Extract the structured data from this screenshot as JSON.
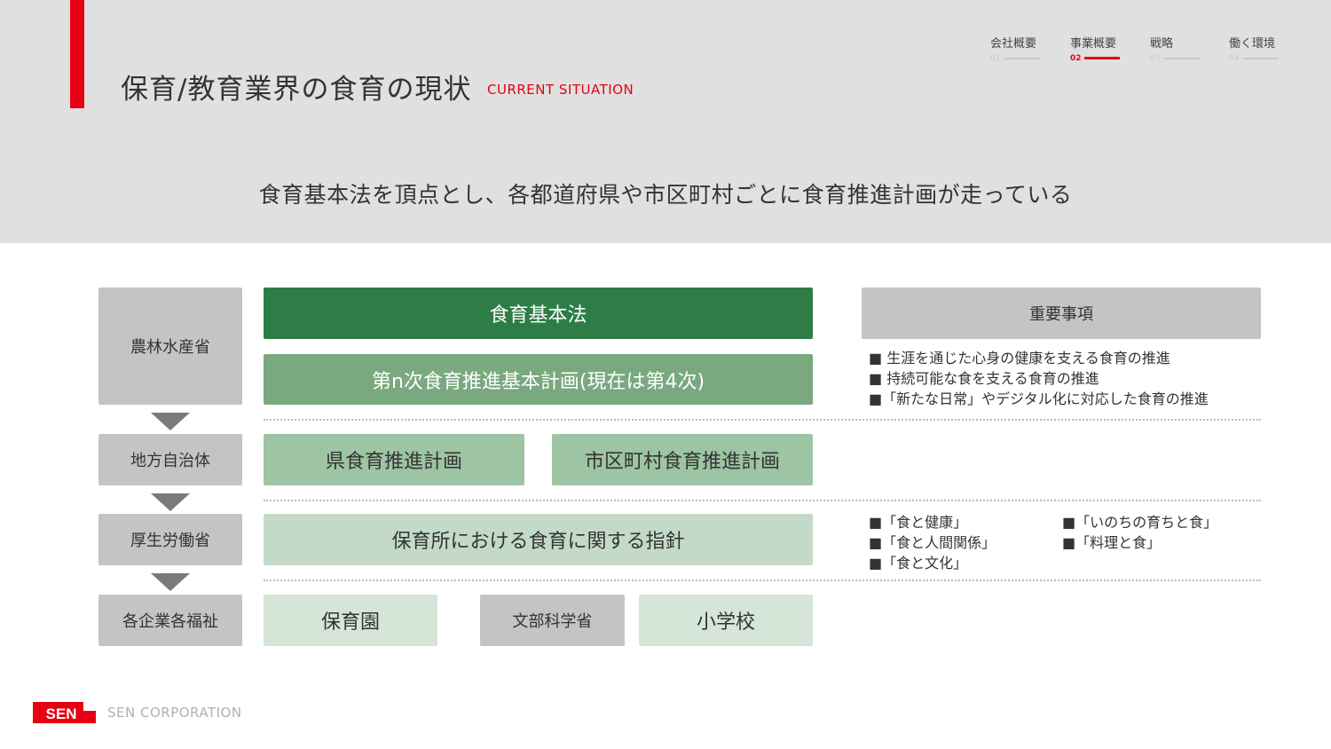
{
  "page": {
    "title": "保育/教育業界の食育の現状",
    "title_en": "CURRENT SITUATION",
    "subtitle": "食育基本法を頂点とし、各都道府県や市区町村ごとに食育推進計画が走っている"
  },
  "nav": [
    {
      "label": "会社概要",
      "num": "01"
    },
    {
      "label": "事業概要",
      "num": "02"
    },
    {
      "label": "戦略",
      "num": "03"
    },
    {
      "label": "働く環境",
      "num": "04"
    }
  ],
  "nav_active_index": 1,
  "diagram": {
    "levels": [
      "農林水産省",
      "地方自治体",
      "厚生労働省",
      "各企業各福祉"
    ],
    "law": "食育基本法",
    "basic_plan": "第n次食育推進基本計画(現在は第4次)",
    "pref_plan": "県食育推進計画",
    "city_plan": "市区町村食育推進計画",
    "guideline": "保育所における食育に関する指針",
    "nursery": "保育園",
    "mext": "文部科学省",
    "elementary": "小学校",
    "important_header": "重要事項",
    "important_items": [
      "■ 生涯を通じた心身の健康を支える食育の推進",
      "■ 持続可能な食を支える食育の推進",
      "■「新たな日常」やデジタル化に対応した食育の推進"
    ],
    "guideline_items": [
      "■「食と健康」",
      "■「いのちの育ちと食」",
      "■「食と人間関係」",
      "■「料理と食」",
      "■「食と文化」"
    ]
  },
  "footer": {
    "logo_text": "SEN",
    "company": "SEN CORPORATION"
  },
  "colors": {
    "accent_red": "#e60012",
    "green_dark": "#2e7d46",
    "green_mid": "#7aa87f",
    "green_light": "#9dc4a3",
    "green_pale": "#c4dac8",
    "gray_box": "#c4c4c4",
    "header_bg": "#e0e0e0"
  }
}
